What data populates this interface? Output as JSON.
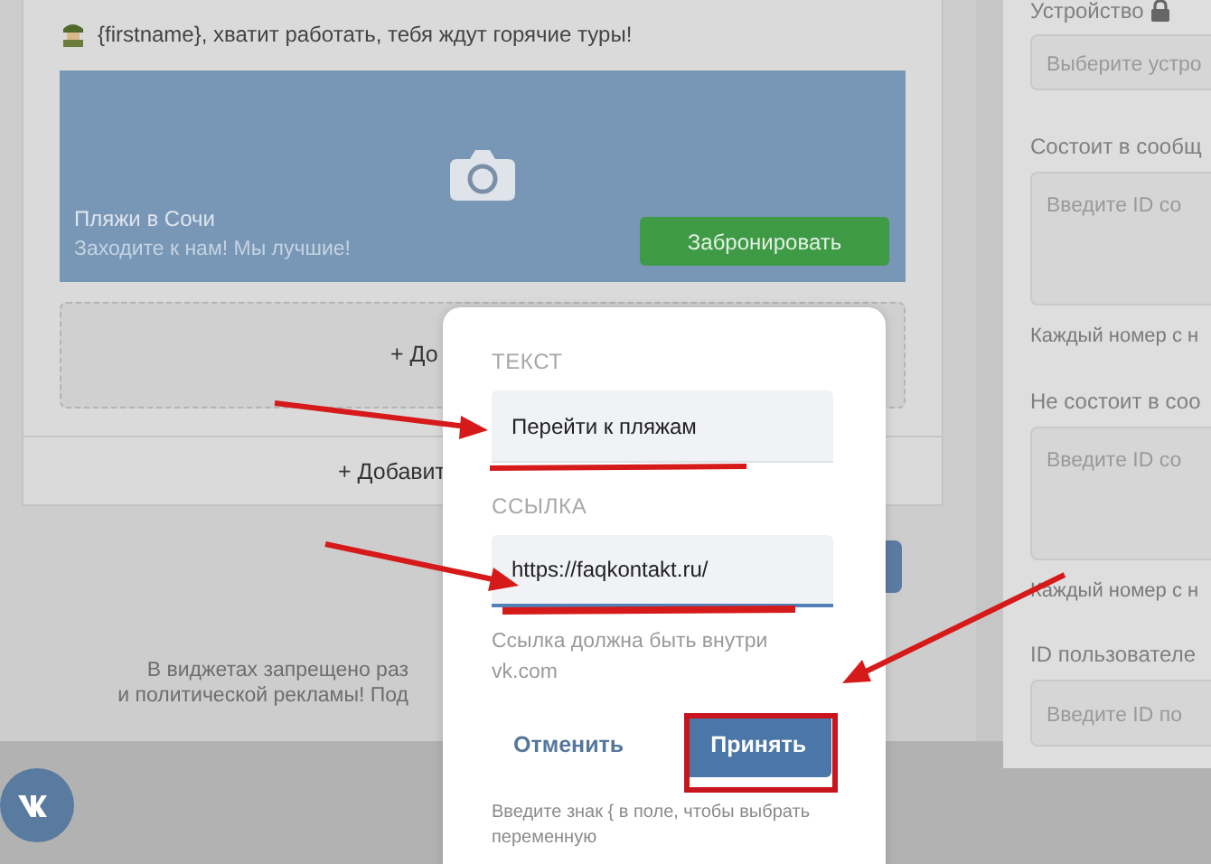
{
  "message": {
    "text": "{firstname}, хватит работать, тебя ждут горячие туры!"
  },
  "widget_card": {
    "title": "Пляжи в Сочи",
    "subtitle": "Заходите к нам! Мы лучшие!",
    "button": "Забронировать"
  },
  "add_area": {
    "label": "+ До"
  },
  "add_row": {
    "label": "+ Добавит"
  },
  "notice": {
    "lines": [
      "В виджетах запрещено раз",
      "и политической рекламы! Под"
    ]
  },
  "modal": {
    "fields": [
      {
        "label": "ТЕКСТ",
        "value": "Перейти к пляжам",
        "focused": false
      },
      {
        "label": "ССЫЛКА",
        "value": "https://faqkontakt.ru/",
        "focused": true
      }
    ],
    "hint": "Ссылка должна быть внутри vk.com",
    "cancel": "Отменить",
    "accept": "Принять",
    "footer": "Введите знак { в поле, чтобы выбрать переменную"
  },
  "sidebar": {
    "fields": [
      {
        "label": "Устройство",
        "locked": true,
        "kind": "select",
        "placeholder": "Выберите устро"
      },
      {
        "label": "Состоит в сообщ",
        "locked": false,
        "kind": "textarea",
        "placeholder": "Введите ID со",
        "note": "Каждый номер с н"
      },
      {
        "label": "Не состоит в соо",
        "locked": false,
        "kind": "textarea",
        "placeholder": "Введите ID со",
        "note": "Каждый номер с н"
      },
      {
        "label": "ID пользователе",
        "locked": false,
        "kind": "input",
        "placeholder": "Введите ID по"
      }
    ]
  }
}
